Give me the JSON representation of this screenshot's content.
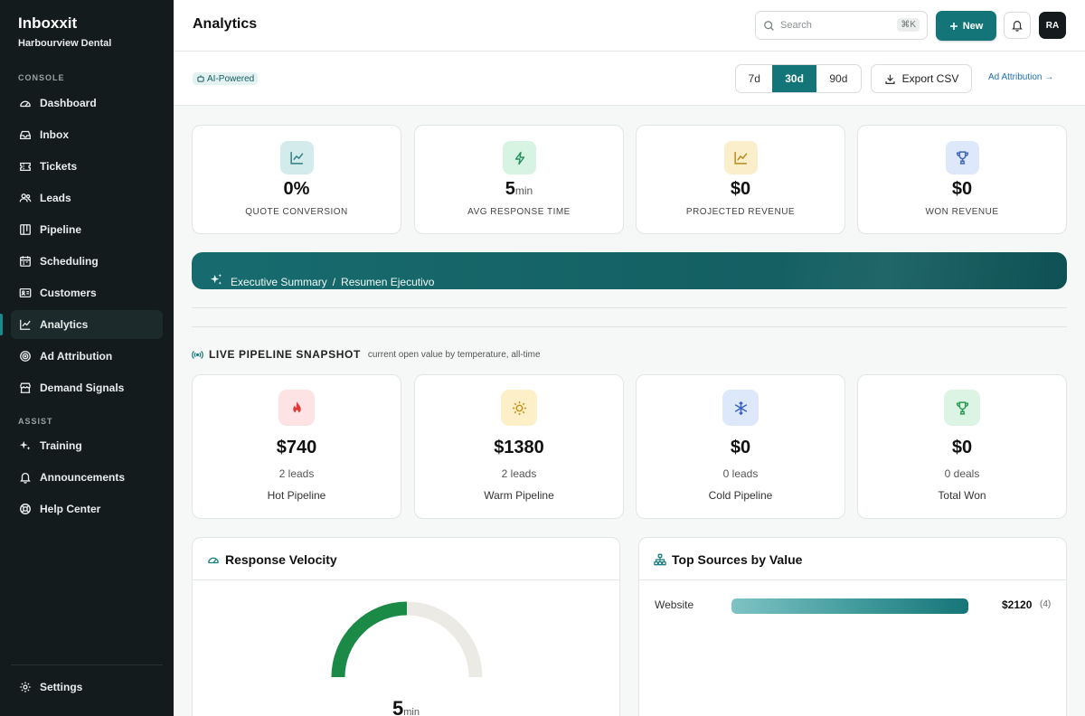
{
  "app": {
    "name": "Inboxxit",
    "org": "Harbourview Dental"
  },
  "sidebar": {
    "console_label": "CONSOLE",
    "assist_label": "ASSIST",
    "items": [
      {
        "label": "Dashboard",
        "icon": "dashboard-icon"
      },
      {
        "label": "Inbox",
        "icon": "inbox-icon"
      },
      {
        "label": "Tickets",
        "icon": "ticket-icon"
      },
      {
        "label": "Leads",
        "icon": "users-icon"
      },
      {
        "label": "Pipeline",
        "icon": "pipeline-icon"
      },
      {
        "label": "Scheduling",
        "icon": "calendar-icon"
      },
      {
        "label": "Customers",
        "icon": "contact-card-icon"
      },
      {
        "label": "Analytics",
        "icon": "chart-line-icon",
        "active": true
      },
      {
        "label": "Ad Attribution",
        "icon": "target-icon"
      },
      {
        "label": "Demand Signals",
        "icon": "storefront-icon"
      }
    ],
    "assist_items": [
      {
        "label": "Training",
        "icon": "sparkle-icon"
      },
      {
        "label": "Announcements",
        "icon": "bell-icon"
      },
      {
        "label": "Help Center",
        "icon": "lifebuoy-icon"
      }
    ],
    "settings_label": "Settings"
  },
  "header": {
    "title": "Analytics",
    "search_placeholder": "Search",
    "search_shortcut": "⌘K",
    "new_label": "New",
    "avatar_initials": "RA"
  },
  "toolbar": {
    "ai_badge": "AI-Powered",
    "ranges": [
      "7d",
      "30d",
      "90d"
    ],
    "selected_range": "30d",
    "export_label": "Export CSV",
    "ad_attribution_link": "Ad Attribution →"
  },
  "kpis": [
    {
      "value": "0%",
      "unit": "",
      "label": "QUOTE CONVERSION",
      "icon": "chart-line-icon",
      "bg": "#d3ebea",
      "fg": "#2f7f80"
    },
    {
      "value": "5",
      "unit": "min",
      "label": "AVG RESPONSE TIME",
      "icon": "lightning-icon",
      "bg": "#d7f3e2",
      "fg": "#23915a"
    },
    {
      "value": "$0",
      "unit": "",
      "label": "PROJECTED REVENUE",
      "icon": "trend-icon",
      "bg": "#fbefcb",
      "fg": "#b88a1c"
    },
    {
      "value": "$0",
      "unit": "",
      "label": "WON REVENUE",
      "icon": "trophy-icon",
      "bg": "#dde8fb",
      "fg": "#3f64b8"
    }
  ],
  "exec_summary": {
    "title": "Executive Summary",
    "sep": "/",
    "title_es": "Resumen Ejecutivo"
  },
  "pipeline_snapshot": {
    "title": "LIVE PIPELINE SNAPSHOT",
    "subtitle": "current open value by temperature, all-time",
    "cards": [
      {
        "value": "$740",
        "count": "2 leads",
        "label": "Hot Pipeline",
        "icon": "flame-icon",
        "bg": "#fde3e3",
        "fg": "#e0393a"
      },
      {
        "value": "$1380",
        "count": "2 leads",
        "label": "Warm Pipeline",
        "icon": "sun-icon",
        "bg": "#fdf0c8",
        "fg": "#c98b16"
      },
      {
        "value": "$0",
        "count": "0 leads",
        "label": "Cold Pipeline",
        "icon": "snowflake-icon",
        "bg": "#dde8fb",
        "fg": "#3a62c0"
      },
      {
        "value": "$0",
        "count": "0 deals",
        "label": "Total Won",
        "icon": "trophy-icon",
        "bg": "#dcf4e3",
        "fg": "#2b9a55"
      }
    ]
  },
  "response_velocity": {
    "title": "Response Velocity",
    "value": "5",
    "unit": "min",
    "gauge_fraction": 0.5,
    "colors": {
      "fill": "#1c8a47",
      "track": "#eceae4"
    }
  },
  "top_sources": {
    "title": "Top Sources by Value",
    "rows": [
      {
        "name": "Website",
        "value": "$2120",
        "count": "(4)",
        "fraction": 1.0
      }
    ]
  }
}
